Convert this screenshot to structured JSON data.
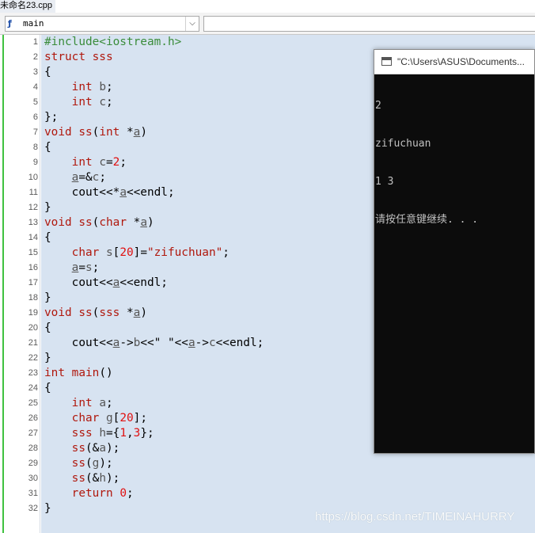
{
  "tab": {
    "title": "未命名23.cpp"
  },
  "toolbar": {
    "function_combo_value": "main",
    "function_icon": "function-icon"
  },
  "console": {
    "title": "\"C:\\Users\\ASUS\\Documents...",
    "output_lines": [
      "2",
      "zifuchuan",
      "1 3",
      "请按任意键继续. . ."
    ]
  },
  "watermark": "https://blog.csdn.net/TIMEINAHURRY",
  "colors": {
    "keyword": "#b0180d",
    "preproc": "#3a8c3a",
    "number": "#e01010",
    "string": "#b0180d",
    "editor_bg": "#d7e3f1"
  },
  "code_lines": [
    {
      "n": "1",
      "segments": [
        {
          "t": "#include<iostream.h>",
          "c": "p"
        }
      ]
    },
    {
      "n": "2",
      "segments": [
        {
          "t": "struct",
          "c": "k"
        },
        {
          "t": " sss",
          "c": "k"
        }
      ]
    },
    {
      "n": "3",
      "segments": [
        {
          "t": "{",
          "c": ""
        }
      ]
    },
    {
      "n": "4",
      "segments": [
        {
          "t": "    ",
          "c": ""
        },
        {
          "t": "int",
          "c": "k"
        },
        {
          "t": " ",
          "c": ""
        },
        {
          "t": "b",
          "c": "v"
        },
        {
          "t": ";",
          "c": ""
        }
      ]
    },
    {
      "n": "5",
      "segments": [
        {
          "t": "    ",
          "c": ""
        },
        {
          "t": "int",
          "c": "k"
        },
        {
          "t": " ",
          "c": ""
        },
        {
          "t": "c",
          "c": "v"
        },
        {
          "t": ";",
          "c": ""
        }
      ]
    },
    {
      "n": "6",
      "segments": [
        {
          "t": "};",
          "c": ""
        }
      ]
    },
    {
      "n": "7",
      "segments": [
        {
          "t": "void",
          "c": "k"
        },
        {
          "t": " ",
          "c": ""
        },
        {
          "t": "ss",
          "c": "k"
        },
        {
          "t": "(",
          "c": ""
        },
        {
          "t": "int",
          "c": "k"
        },
        {
          "t": " *",
          "c": ""
        },
        {
          "t": "a",
          "c": "u"
        },
        {
          "t": ")",
          "c": ""
        }
      ]
    },
    {
      "n": "8",
      "segments": [
        {
          "t": "{",
          "c": ""
        }
      ]
    },
    {
      "n": "9",
      "segments": [
        {
          "t": "    ",
          "c": ""
        },
        {
          "t": "int",
          "c": "k"
        },
        {
          "t": " ",
          "c": ""
        },
        {
          "t": "c",
          "c": "v"
        },
        {
          "t": "=",
          "c": ""
        },
        {
          "t": "2",
          "c": "n"
        },
        {
          "t": ";",
          "c": ""
        }
      ]
    },
    {
      "n": "10",
      "segments": [
        {
          "t": "    ",
          "c": ""
        },
        {
          "t": "a",
          "c": "u"
        },
        {
          "t": "=&",
          "c": ""
        },
        {
          "t": "c",
          "c": "v"
        },
        {
          "t": ";",
          "c": ""
        }
      ]
    },
    {
      "n": "11",
      "segments": [
        {
          "t": "    cout<<*",
          "c": ""
        },
        {
          "t": "a",
          "c": "u"
        },
        {
          "t": "<<endl;",
          "c": ""
        }
      ]
    },
    {
      "n": "12",
      "segments": [
        {
          "t": "}",
          "c": ""
        }
      ]
    },
    {
      "n": "13",
      "segments": [
        {
          "t": "void",
          "c": "k"
        },
        {
          "t": " ",
          "c": ""
        },
        {
          "t": "ss",
          "c": "k"
        },
        {
          "t": "(",
          "c": ""
        },
        {
          "t": "char",
          "c": "k"
        },
        {
          "t": " *",
          "c": ""
        },
        {
          "t": "a",
          "c": "u"
        },
        {
          "t": ")",
          "c": ""
        }
      ]
    },
    {
      "n": "14",
      "segments": [
        {
          "t": "{",
          "c": ""
        }
      ]
    },
    {
      "n": "15",
      "segments": [
        {
          "t": "    ",
          "c": ""
        },
        {
          "t": "char",
          "c": "k"
        },
        {
          "t": " ",
          "c": ""
        },
        {
          "t": "s",
          "c": "v"
        },
        {
          "t": "[",
          "c": ""
        },
        {
          "t": "20",
          "c": "n"
        },
        {
          "t": "]=",
          "c": ""
        },
        {
          "t": "\"zifuchuan\"",
          "c": "s"
        },
        {
          "t": ";",
          "c": ""
        }
      ]
    },
    {
      "n": "16",
      "segments": [
        {
          "t": "    ",
          "c": ""
        },
        {
          "t": "a",
          "c": "u"
        },
        {
          "t": "=",
          "c": ""
        },
        {
          "t": "s",
          "c": "v"
        },
        {
          "t": ";",
          "c": ""
        }
      ]
    },
    {
      "n": "17",
      "segments": [
        {
          "t": "    cout<<",
          "c": ""
        },
        {
          "t": "a",
          "c": "u"
        },
        {
          "t": "<<endl;",
          "c": ""
        }
      ]
    },
    {
      "n": "18",
      "segments": [
        {
          "t": "}",
          "c": ""
        }
      ]
    },
    {
      "n": "19",
      "segments": [
        {
          "t": "void",
          "c": "k"
        },
        {
          "t": " ",
          "c": ""
        },
        {
          "t": "ss",
          "c": "k"
        },
        {
          "t": "(",
          "c": ""
        },
        {
          "t": "sss",
          "c": "k"
        },
        {
          "t": " *",
          "c": ""
        },
        {
          "t": "a",
          "c": "u"
        },
        {
          "t": ")",
          "c": ""
        }
      ]
    },
    {
      "n": "20",
      "segments": [
        {
          "t": "{",
          "c": ""
        }
      ]
    },
    {
      "n": "21",
      "segments": [
        {
          "t": "    cout<<",
          "c": ""
        },
        {
          "t": "a",
          "c": "u"
        },
        {
          "t": "->",
          "c": ""
        },
        {
          "t": "b",
          "c": "v"
        },
        {
          "t": "<<\" \"<<",
          "c": ""
        },
        {
          "t": "a",
          "c": "u"
        },
        {
          "t": "->",
          "c": ""
        },
        {
          "t": "c",
          "c": "v"
        },
        {
          "t": "<<endl;",
          "c": ""
        }
      ]
    },
    {
      "n": "22",
      "segments": [
        {
          "t": "}",
          "c": ""
        }
      ]
    },
    {
      "n": "23",
      "segments": [
        {
          "t": "int",
          "c": "k"
        },
        {
          "t": " ",
          "c": ""
        },
        {
          "t": "main",
          "c": "k"
        },
        {
          "t": "()",
          "c": ""
        }
      ]
    },
    {
      "n": "24",
      "segments": [
        {
          "t": "{",
          "c": ""
        }
      ]
    },
    {
      "n": "25",
      "segments": [
        {
          "t": "    ",
          "c": ""
        },
        {
          "t": "int",
          "c": "k"
        },
        {
          "t": " ",
          "c": ""
        },
        {
          "t": "a",
          "c": "v"
        },
        {
          "t": ";",
          "c": ""
        }
      ]
    },
    {
      "n": "26",
      "segments": [
        {
          "t": "    ",
          "c": ""
        },
        {
          "t": "char",
          "c": "k"
        },
        {
          "t": " ",
          "c": ""
        },
        {
          "t": "g",
          "c": "v"
        },
        {
          "t": "[",
          "c": ""
        },
        {
          "t": "20",
          "c": "n"
        },
        {
          "t": "];",
          "c": ""
        }
      ]
    },
    {
      "n": "27",
      "segments": [
        {
          "t": "    ",
          "c": ""
        },
        {
          "t": "sss",
          "c": "k"
        },
        {
          "t": " ",
          "c": ""
        },
        {
          "t": "h",
          "c": "v"
        },
        {
          "t": "={",
          "c": ""
        },
        {
          "t": "1",
          "c": "n"
        },
        {
          "t": ",",
          "c": ""
        },
        {
          "t": "3",
          "c": "n"
        },
        {
          "t": "};",
          "c": ""
        }
      ]
    },
    {
      "n": "28",
      "segments": [
        {
          "t": "    ",
          "c": ""
        },
        {
          "t": "ss",
          "c": "k"
        },
        {
          "t": "(&",
          "c": ""
        },
        {
          "t": "a",
          "c": "v"
        },
        {
          "t": ");",
          "c": ""
        }
      ]
    },
    {
      "n": "29",
      "segments": [
        {
          "t": "    ",
          "c": ""
        },
        {
          "t": "ss",
          "c": "k"
        },
        {
          "t": "(",
          "c": ""
        },
        {
          "t": "g",
          "c": "v"
        },
        {
          "t": ");",
          "c": ""
        }
      ]
    },
    {
      "n": "30",
      "segments": [
        {
          "t": "    ",
          "c": ""
        },
        {
          "t": "ss",
          "c": "k"
        },
        {
          "t": "(&",
          "c": ""
        },
        {
          "t": "h",
          "c": "v"
        },
        {
          "t": ");",
          "c": ""
        }
      ]
    },
    {
      "n": "31",
      "segments": [
        {
          "t": "    ",
          "c": ""
        },
        {
          "t": "return",
          "c": "k"
        },
        {
          "t": " ",
          "c": ""
        },
        {
          "t": "0",
          "c": "n"
        },
        {
          "t": ";",
          "c": ""
        }
      ]
    },
    {
      "n": "32",
      "segments": [
        {
          "t": "}",
          "c": ""
        }
      ]
    }
  ]
}
